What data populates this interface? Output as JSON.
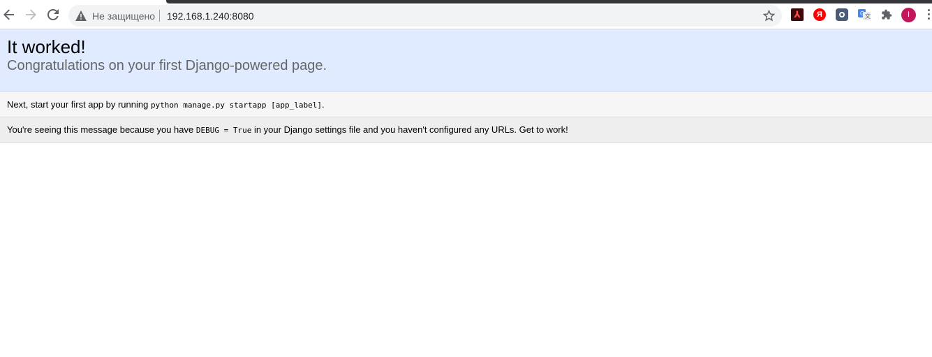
{
  "browser": {
    "security_label": "Не защищено",
    "url": "192.168.1.240:8080",
    "avatar_letter": "I",
    "extensions": [
      {
        "name": "adobe-acrobat-icon",
        "glyph": "⅄"
      },
      {
        "name": "yandex-icon",
        "glyph": "Я"
      },
      {
        "name": "extension-puzzle-icon"
      },
      {
        "name": "google-translate-icon"
      },
      {
        "name": "extensions-menu-icon"
      }
    ]
  },
  "page": {
    "title": "It worked!",
    "subtitle": "Congratulations on your first Django-powered page.",
    "instructions": {
      "text_before": "Next, start your first app by running ",
      "code": "python manage.py startapp [app_label]",
      "text_after": "."
    },
    "explanation": {
      "text_before": "You're seeing this message because you have ",
      "code": "DEBUG = True",
      "text_after": " in your Django settings file and you haven't configured any URLs. Get to work!"
    }
  },
  "colors": {
    "summary_bg": "#e0ebff",
    "instructions_bg": "#f6f6f6",
    "explanation_bg": "#eeeeee",
    "avatar": "#c2185b"
  }
}
